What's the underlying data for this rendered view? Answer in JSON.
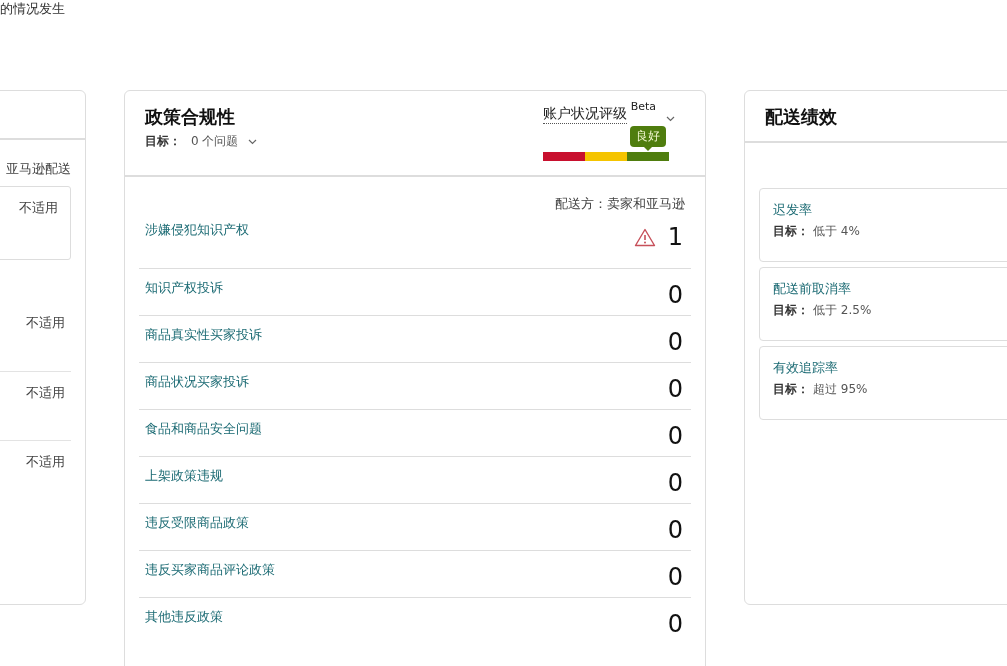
{
  "top_note": "的情况发生",
  "left_panel": {
    "fulfillment": "亚马逊配送",
    "box_value": "不适用",
    "rows": [
      {
        "value": "不适用"
      },
      {
        "value": "不适用"
      },
      {
        "value": "不适用"
      }
    ]
  },
  "policy_panel": {
    "title": "政策合规性",
    "target_label": "目标：",
    "target_value": "0 个问题",
    "rating": {
      "label": "账户状况评级",
      "badge": "Beta",
      "status": "良好",
      "level": 0.83
    },
    "fulfilled_by": "配送方：卖家和亚马逊",
    "rows": [
      {
        "label": "涉嫌侵犯知识产权",
        "count": "1",
        "warning": true
      },
      {
        "label": "知识产权投诉",
        "count": "0",
        "warning": false
      },
      {
        "label": "商品真实性买家投诉",
        "count": "0",
        "warning": false
      },
      {
        "label": "商品状况买家投诉",
        "count": "0",
        "warning": false
      },
      {
        "label": "食品和商品安全问题",
        "count": "0",
        "warning": false
      },
      {
        "label": "上架政策违规",
        "count": "0",
        "warning": false
      },
      {
        "label": "违反受限商品政策",
        "count": "0",
        "warning": false
      },
      {
        "label": "违反买家商品评论政策",
        "count": "0",
        "warning": false
      },
      {
        "label": "其他违反政策",
        "count": "0",
        "warning": false
      }
    ]
  },
  "shipping_panel": {
    "title": "配送绩效",
    "metrics": [
      {
        "name": "迟发率",
        "target_label": "目标：",
        "target_value": "低于 4%"
      },
      {
        "name": "配送前取消率",
        "target_label": "目标：",
        "target_value": "低于 2.5%"
      },
      {
        "name": "有效追踪率",
        "target_label": "目标：",
        "target_value": "超过 95%"
      }
    ]
  }
}
